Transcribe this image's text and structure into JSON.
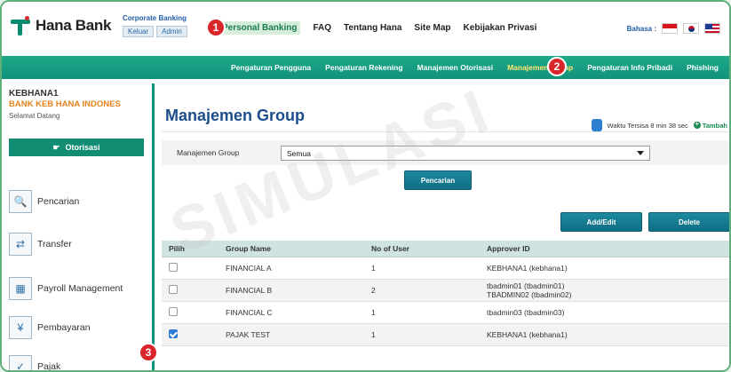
{
  "header": {
    "logo_text": "Hana Bank",
    "corporate_title": "Corporate Banking",
    "corporate_buttons": [
      "Keluar",
      "Admin"
    ],
    "nav": [
      "Personal Banking",
      "FAQ",
      "Tentang Hana",
      "Site Map",
      "Kebijakan Privasi"
    ],
    "language_label": "Bahasa :"
  },
  "menubar": {
    "items": [
      "Pengaturan Pengguna",
      "Pengaturan Rekening",
      "Manajemen Otorisasi",
      "Manajemen Group",
      "Pengaturan Info Pribadi",
      "Phishing"
    ]
  },
  "sidebar": {
    "user_id": "KEBHANA1",
    "bank_name": "BANK KEB HANA INDONES",
    "welcome": "Selamat Datang",
    "otorisasi_label": "Otorisasi",
    "items": [
      "Pencarian",
      "Transfer",
      "Payroll Management",
      "Pembayaran",
      "Pajak"
    ]
  },
  "main": {
    "title": "Manajemen Group",
    "session_text": "Waktu Tersisa 8 min 38 sec",
    "tambah_label": "Tambah",
    "filter_label": "Manajemen Group",
    "filter_value": "Semua",
    "search_button": "Pencarian",
    "addedit_button": "Add/Edit",
    "delete_button": "Delete",
    "table": {
      "headers": [
        "Pilih",
        "Group Name",
        "No of User",
        "Approver ID"
      ],
      "rows": [
        {
          "group": "FINANCIAL A",
          "users": "1",
          "approver": "KEBHANA1 (kebhana1)",
          "approver2": "",
          "checked": false
        },
        {
          "group": "FINANCIAL B",
          "users": "2",
          "approver": "tbadmin01 (tbadmin01)",
          "approver2": "TBADMIN02 (tbadmin02)",
          "checked": false
        },
        {
          "group": "FINANCIAL C",
          "users": "1",
          "approver": "tbadmin03 (tbadmin03)",
          "approver2": "",
          "checked": false
        },
        {
          "group": "PAJAK TEST",
          "users": "1",
          "approver": "KEBHANA1 (kebhana1)",
          "approver2": "",
          "checked": true
        }
      ]
    }
  },
  "badges": [
    "1",
    "2",
    "3"
  ],
  "watermark": "SIMULASI",
  "colors": {
    "brand_green": "#11927a",
    "title_blue": "#1d4d8b",
    "badge_red": "#d8262b",
    "bank_orange": "#e4821d"
  }
}
